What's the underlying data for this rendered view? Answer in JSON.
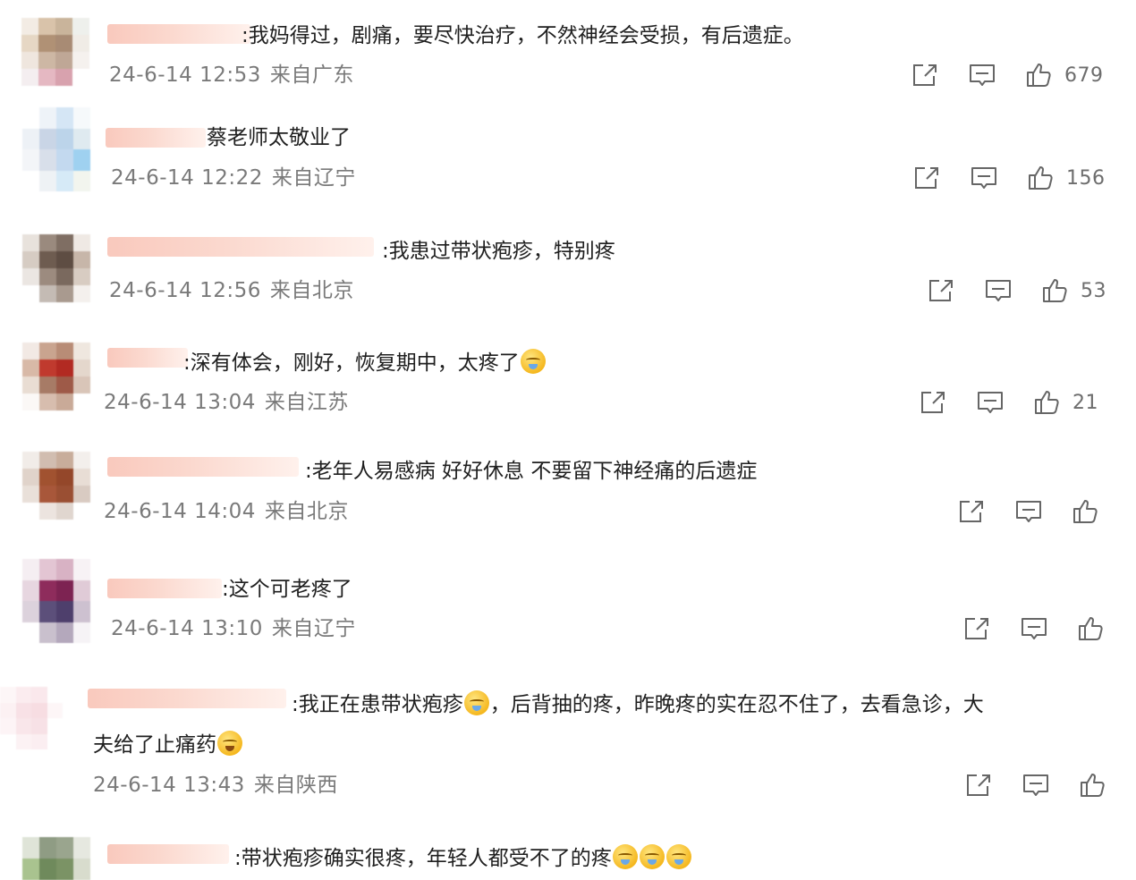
{
  "comments": [
    {
      "text": ":我妈得过，剧痛，要尽快治疗，不然神经会受损，有后遗症。",
      "time": "24-6-14 12:53",
      "location": "来自广东",
      "likes": "679"
    },
    {
      "text": "蔡老师太敬业了",
      "time": "24-6-14 12:22",
      "location": "来自辽宁",
      "likes": "156"
    },
    {
      "text": ":我患过带状疱疹，特别疼",
      "time": "24-6-14 12:56",
      "location": "来自北京",
      "likes": "53"
    },
    {
      "text": ":深有体会，刚好，恢复期中，太疼了",
      "time": "24-6-14 13:04",
      "location": "来自江苏",
      "likes": "21"
    },
    {
      "text": ":老年人易感病 好好休息 不要留下神经痛的后遗症",
      "time": "24-6-14 14:04",
      "location": "来自北京",
      "likes": ""
    },
    {
      "text": ":这个可老疼了",
      "time": "24-6-14 13:10",
      "location": "来自辽宁",
      "likes": ""
    },
    {
      "text_part1": ":我正在患带状疱疹",
      "text_part2": "，后背抽的疼，昨晚疼的实在忍不住了，去看急诊，大",
      "text_part3": "夫给了止痛药",
      "time": "24-6-14 13:43",
      "location": "来自陕西",
      "likes": ""
    },
    {
      "text": ":带状疱疹确实很疼，年轻人都受不了的疼",
      "time": "",
      "location": "",
      "likes": ""
    }
  ],
  "icons": {
    "share": "share-icon",
    "comment": "comment-icon",
    "like": "thumbs-up-icon"
  }
}
